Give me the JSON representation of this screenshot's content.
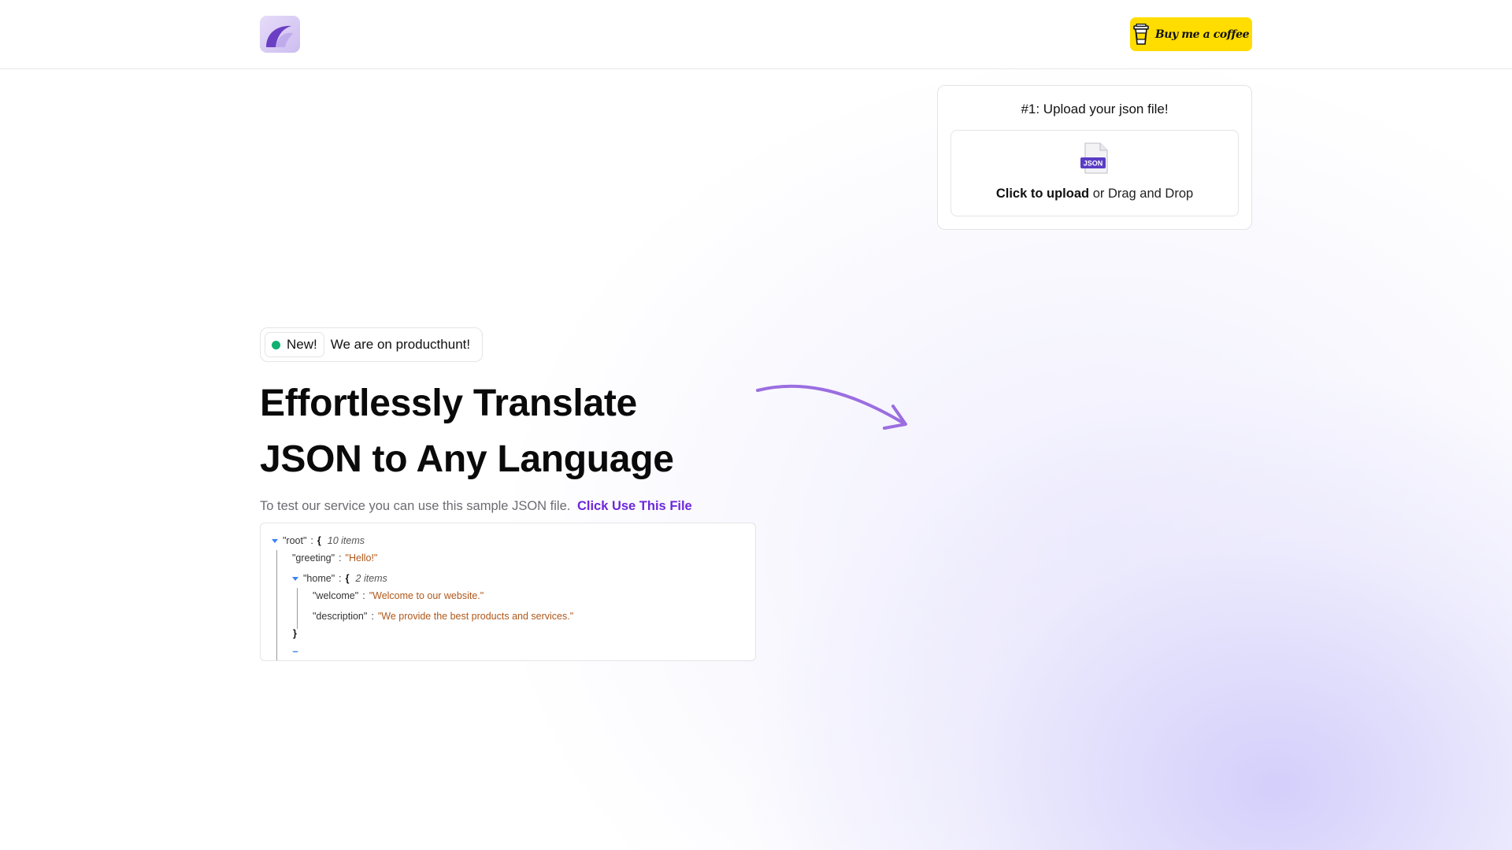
{
  "header": {
    "logo_icon": "app-logo-icon",
    "bmc_button_label": "Buy me a coffee",
    "bmc_icon": "coffee-cup-icon",
    "bmc_color": "#ffdd00"
  },
  "upload": {
    "title": "#1: Upload your json file!",
    "file_icon_label": "JSON",
    "click_label": "Click to upload",
    "drag_label": "or Drag and Drop"
  },
  "badge": {
    "new_label": "New!",
    "text": "We are on producthunt!"
  },
  "hero": {
    "title_line1": "Effortlessly Translate",
    "title_line2": "JSON to Any Language",
    "sample_text": "To test our service you can use this sample JSON file.",
    "sample_link": "Click Use This File",
    "accent_color": "#6d28d9"
  },
  "json_viewer": {
    "root_key": "\"root\"",
    "root_count": "10 items",
    "greeting_key": "\"greeting\"",
    "greeting_value": "\"Hello!\"",
    "home_key": "\"home\"",
    "home_count": "2 items",
    "welcome_key": "\"welcome\"",
    "welcome_value": "\"Welcome to our website.\"",
    "description_key": "\"description\"",
    "description_value": "\"We provide the best products and services.\"",
    "colon": ":",
    "open_brace": "{",
    "close_brace": "}"
  }
}
